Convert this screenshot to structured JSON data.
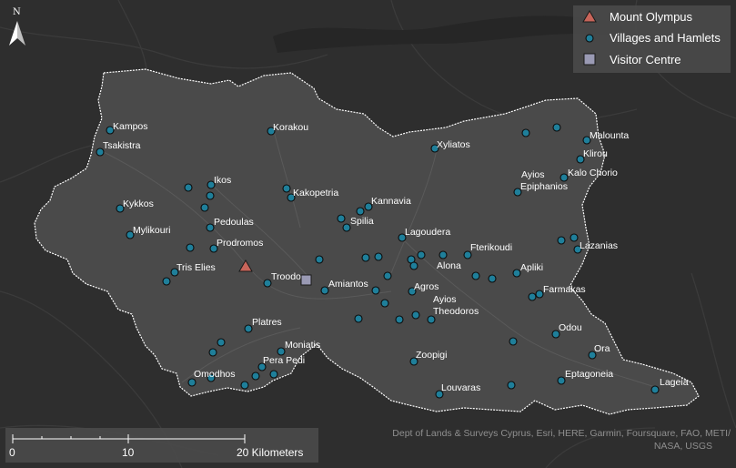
{
  "legend": {
    "items": [
      {
        "label": "Mount Olympus",
        "symbol": "triangle",
        "color": "#c8655a"
      },
      {
        "label": "Villages and Hamlets",
        "symbol": "circle",
        "color": "#1f7f9a"
      },
      {
        "label": "Visitor Centre",
        "symbol": "square",
        "color": "#9a9ab4"
      }
    ]
  },
  "north_arrow": {
    "label": "N"
  },
  "scale_bar": {
    "ticks": [
      "0",
      "10",
      "20 Kilometers"
    ]
  },
  "attribution": {
    "line1": "Dept of Lands & Surveys  Cyprus, Esri, HERE, Garmin, Foursquare, FAO, METI/",
    "line2": "NASA, USGS"
  },
  "places": {
    "kampos": "Kampos",
    "tsakistra": "Tsakistra",
    "korakou": "Korakou",
    "xyliatos": "Xyliatos",
    "malounta": "Malounta",
    "klirou": "Klirou",
    "kalo_chorio": "Kalo Chorio",
    "ayios_epiphanios_1": "Ayios",
    "ayios_epiphanios_2": "Epiphanios",
    "ikos": "Ikos",
    "kakopetria": "Kakopetria",
    "kannavia": "Kannavia",
    "kykkos": "Kykkos",
    "spilia": "Spilia",
    "pedoulas": "Pedoulas",
    "lagoudera": "Lagoudera",
    "mylikouri": "Mylikouri",
    "prodromos": "Prodromos",
    "fterikoudi": "Fterikoudi",
    "lazanias": "Lazanias",
    "tris_elies": "Tris Elies",
    "alona": "Alona",
    "apliki": "Apliki",
    "troodos": "Troodos",
    "amiantos": "Amiantos",
    "agros": "Agros",
    "farmakas": "Farmakas",
    "ayios_theodoros_1": "Ayios",
    "ayios_theodoros_2": "Theodoros",
    "platres": "Platres",
    "odou": "Odou",
    "moniatis": "Moniatis",
    "ora": "Ora",
    "pera_pedi": "Pera Pedi",
    "omodhos": "Omodhos",
    "zoopigi": "Zoopigi",
    "eptagoneia": "Eptagoneia",
    "lageia": "Lageia",
    "louvaras": "Louvaras"
  }
}
